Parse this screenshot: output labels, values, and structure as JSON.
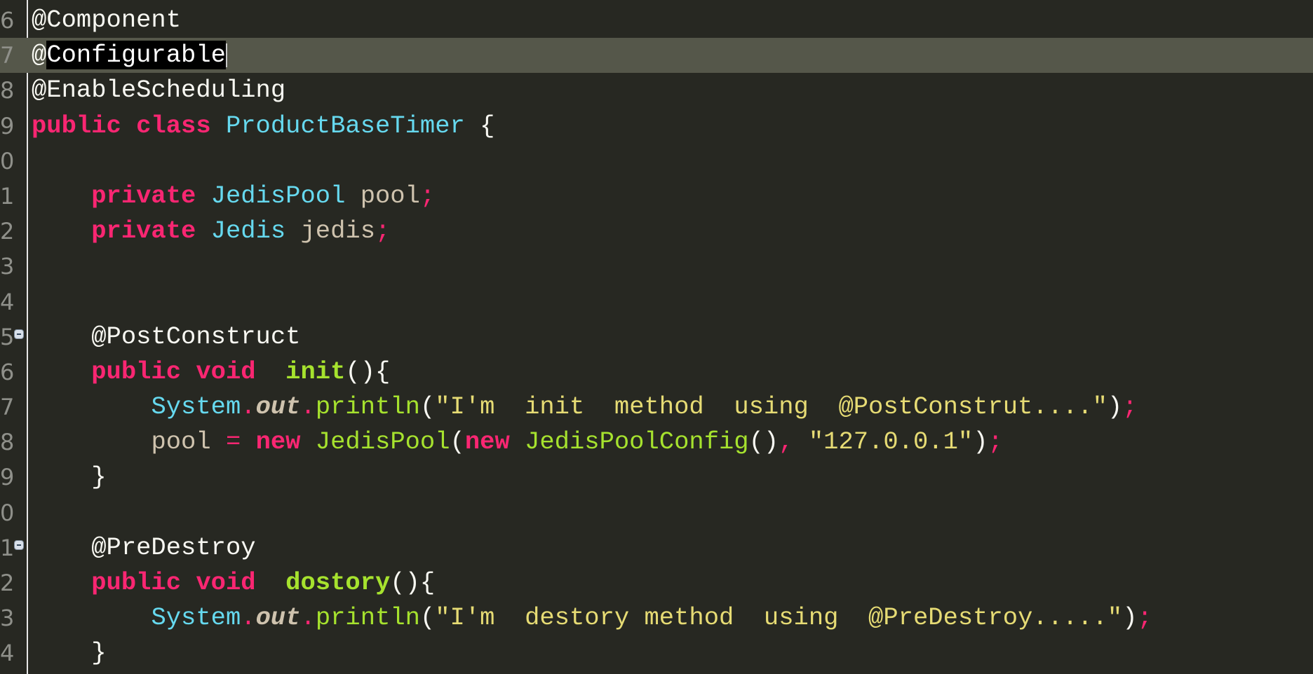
{
  "editor": {
    "theme_colors": {
      "background": "#272822",
      "keyword": "#f92672",
      "type": "#66d9ef",
      "function": "#a6e22e",
      "string": "#e6db74",
      "current_line": "#55574a"
    },
    "current_line_index": 1,
    "lines": [
      {
        "num": "6",
        "tokens": [
          [
            "@Component",
            "ann"
          ]
        ]
      },
      {
        "num": "7",
        "tokens": [
          [
            "@",
            "ann"
          ],
          [
            "Configurable",
            "sel"
          ]
        ],
        "caret": true
      },
      {
        "num": "8",
        "tokens": [
          [
            "@EnableScheduling",
            "ann"
          ]
        ]
      },
      {
        "num": "9",
        "tokens": [
          [
            "public class ",
            "kw"
          ],
          [
            "ProductBaseTimer",
            "type"
          ],
          [
            " {",
            "punc"
          ]
        ]
      },
      {
        "num": "0",
        "tokens": []
      },
      {
        "num": "1",
        "tokens": [
          [
            "    ",
            "punc"
          ],
          [
            "private ",
            "kw"
          ],
          [
            "JedisPool ",
            "type"
          ],
          [
            "pool",
            "var"
          ],
          [
            ";",
            "semi"
          ]
        ]
      },
      {
        "num": "2",
        "tokens": [
          [
            "    ",
            "punc"
          ],
          [
            "private ",
            "kw"
          ],
          [
            "Jedis ",
            "type"
          ],
          [
            "jedis",
            "var"
          ],
          [
            ";",
            "semi"
          ]
        ]
      },
      {
        "num": "3",
        "tokens": []
      },
      {
        "num": "4",
        "tokens": []
      },
      {
        "num": "5",
        "fold": true,
        "tokens": [
          [
            "    @PostConstruct",
            "ann"
          ]
        ]
      },
      {
        "num": "6",
        "tokens": [
          [
            "    ",
            "punc"
          ],
          [
            "public void  ",
            "kw"
          ],
          [
            "init",
            "fn"
          ],
          [
            "(){",
            "punc"
          ]
        ]
      },
      {
        "num": "7",
        "tokens": [
          [
            "        ",
            "punc"
          ],
          [
            "System",
            "type"
          ],
          [
            ".",
            "semi"
          ],
          [
            "out",
            "field"
          ],
          [
            ".",
            "semi"
          ],
          [
            "println",
            "call"
          ],
          [
            "(",
            "punc"
          ],
          [
            "\"I'm  init  method  using  @PostConstrut....\"",
            "str"
          ],
          [
            ")",
            "punc"
          ],
          [
            ";",
            "semi"
          ]
        ]
      },
      {
        "num": "8",
        "tokens": [
          [
            "        ",
            "punc"
          ],
          [
            "pool",
            "var"
          ],
          [
            " = ",
            "semi"
          ],
          [
            "new ",
            "kw"
          ],
          [
            "JedisPool",
            "call"
          ],
          [
            "(",
            "punc"
          ],
          [
            "new ",
            "kw"
          ],
          [
            "JedisPoolConfig",
            "call"
          ],
          [
            "()",
            "punc"
          ],
          [
            ", ",
            "semi"
          ],
          [
            "\"127.0.0.1\"",
            "str"
          ],
          [
            ")",
            "punc"
          ],
          [
            ";",
            "semi"
          ]
        ]
      },
      {
        "num": "9",
        "tokens": [
          [
            "    }",
            "punc"
          ]
        ]
      },
      {
        "num": "0",
        "tokens": []
      },
      {
        "num": "1",
        "fold": true,
        "tokens": [
          [
            "    @PreDestroy",
            "ann"
          ]
        ]
      },
      {
        "num": "2",
        "tokens": [
          [
            "    ",
            "punc"
          ],
          [
            "public void  ",
            "kw"
          ],
          [
            "dostory",
            "fn"
          ],
          [
            "(){",
            "punc"
          ]
        ]
      },
      {
        "num": "3",
        "tokens": [
          [
            "        ",
            "punc"
          ],
          [
            "System",
            "type"
          ],
          [
            ".",
            "semi"
          ],
          [
            "out",
            "field"
          ],
          [
            ".",
            "semi"
          ],
          [
            "println",
            "call"
          ],
          [
            "(",
            "punc"
          ],
          [
            "\"I'm  destory method  using  @PreDestroy.....\"",
            "str"
          ],
          [
            ")",
            "punc"
          ],
          [
            ";",
            "semi"
          ]
        ]
      },
      {
        "num": "4",
        "tokens": [
          [
            "    }",
            "punc"
          ]
        ]
      }
    ]
  }
}
